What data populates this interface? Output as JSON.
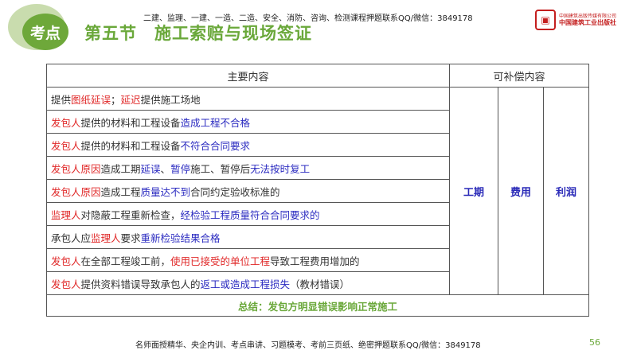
{
  "header": {
    "badge": "考点",
    "title": "第五节　施工索赔与现场签证",
    "note": "二建、监理、一建、一造、二造、安全、消防、咨询、检测课程押题联系QQ/微信：3849178",
    "publisher_top": "中国建筑出版传媒有限公司",
    "publisher_bottom": "中国建筑工业出版社"
  },
  "table": {
    "headers": [
      "主要内容",
      "可补偿内容"
    ],
    "compensation": [
      "工期",
      "费用",
      "利润"
    ],
    "rows": [
      [
        [
          "提供",
          "dark"
        ],
        [
          "图纸延误",
          "red"
        ],
        [
          "；",
          "dark"
        ],
        [
          "延迟",
          "red"
        ],
        [
          "提供施工场地",
          "dark"
        ]
      ],
      [
        [
          "发包人",
          "red"
        ],
        [
          "提供的材料和工程设备",
          "dark"
        ],
        [
          "造成工程不合格",
          "blue"
        ]
      ],
      [
        [
          "发包人",
          "red"
        ],
        [
          "提供的材料和工程设备",
          "dark"
        ],
        [
          "不符合合同要求",
          "blue"
        ]
      ],
      [
        [
          "发包人原因",
          "red"
        ],
        [
          "造成工期",
          "dark"
        ],
        [
          "延误",
          "blue"
        ],
        [
          "、",
          "dark"
        ],
        [
          "暂停",
          "blue"
        ],
        [
          "施工、暂停后",
          "dark"
        ],
        [
          "无法按时复工",
          "blue"
        ]
      ],
      [
        [
          "发包人原因",
          "red"
        ],
        [
          "造成工程",
          "dark"
        ],
        [
          "质量达不到",
          "blue"
        ],
        [
          "合同约定验收标准的",
          "dark"
        ]
      ],
      [
        [
          "监理人",
          "red"
        ],
        [
          "对隐蔽工程重新检查，",
          "dark"
        ],
        [
          "经检验工程质量符合合同要求的",
          "blue"
        ]
      ],
      [
        [
          "承包人应",
          "dark"
        ],
        [
          "监理人",
          "red"
        ],
        [
          "要求",
          "dark"
        ],
        [
          "重新检验结果合格",
          "blue"
        ]
      ],
      [
        [
          "发包人",
          "red"
        ],
        [
          "在全部工程竣工前，",
          "dark"
        ],
        [
          "使用已接受的单位工程",
          "red"
        ],
        [
          "导致工程费用增加的",
          "dark"
        ]
      ],
      [
        [
          "发包人",
          "red"
        ],
        [
          "提供资料错误导致承包人的",
          "dark"
        ],
        [
          "返工或造成工程损失",
          "blue"
        ],
        [
          "（教材错误）",
          "dark"
        ]
      ]
    ],
    "summary": "总结：发包方明显错误影响正常施工"
  },
  "footer": {
    "text": "名师面授精华、央企内训、考点串讲、习题模考、考前三页纸、绝密押题联系QQ/微信：3849178",
    "page": "56"
  }
}
